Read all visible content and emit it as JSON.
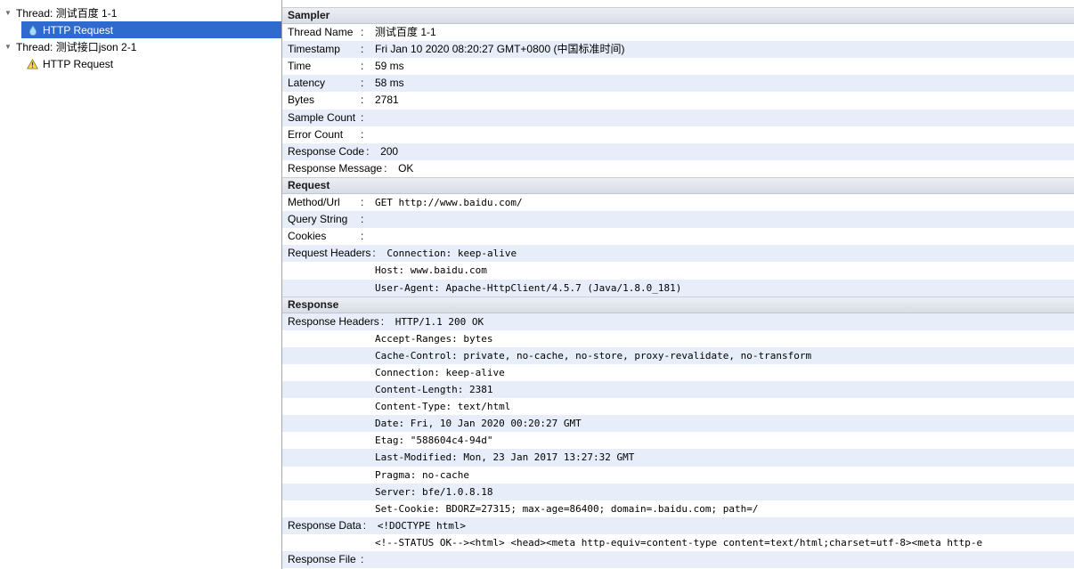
{
  "colors": {
    "selection_blue": "#2f6bce",
    "row_stripe_blue": "#e7eef9",
    "section_header_bg": "#dde1ea",
    "warning_yellow": "#ffd94a"
  },
  "field_separator": ":",
  "tree": {
    "items": [
      {
        "kind": "thread",
        "label": "Thread: 测试百度 1-1",
        "icon": "disclosure-triangle-icon",
        "selected": false
      },
      {
        "kind": "sampler",
        "label": "HTTP Request",
        "icon": "http-request-icon",
        "selected": true
      },
      {
        "kind": "thread",
        "label": "Thread: 测试接口json 2-1",
        "icon": "disclosure-triangle-icon",
        "selected": false
      },
      {
        "kind": "sampler",
        "label": "HTTP Request",
        "icon": "warning-icon",
        "selected": false
      }
    ]
  },
  "result": {
    "sections": [
      {
        "title": "Sampler",
        "rows": [
          {
            "label": "Thread Name",
            "value": "测试百度 1-1",
            "mono": false
          },
          {
            "label": "Timestamp",
            "value": "Fri Jan 10 2020 08:20:27 GMT+0800 (中国标准时间)",
            "mono": false
          },
          {
            "label": "Time",
            "value": "59 ms",
            "mono": false
          },
          {
            "label": "Latency",
            "value": "58 ms",
            "mono": false
          },
          {
            "label": "Bytes",
            "value": "2781",
            "mono": false
          },
          {
            "label": "Sample Count",
            "value": "",
            "mono": false
          },
          {
            "label": "Error Count",
            "value": "",
            "mono": false
          },
          {
            "label": "Response Code",
            "value": "200",
            "mono": false
          },
          {
            "label": "Response Message",
            "value": "OK",
            "mono": false
          }
        ]
      },
      {
        "title": "Request",
        "rows": [
          {
            "label": "Method/Url",
            "value": "GET http://www.baidu.com/",
            "mono": true
          },
          {
            "label": "Query String",
            "value": "",
            "mono": true
          },
          {
            "label": "Cookies",
            "value": "",
            "mono": true
          },
          {
            "label": "Request Headers",
            "mono": true,
            "values": [
              "Connection: keep-alive",
              "Host: www.baidu.com",
              "User-Agent: Apache-HttpClient/4.5.7 (Java/1.8.0_181)"
            ]
          }
        ]
      },
      {
        "title": "Response",
        "rows": [
          {
            "label": "Response Headers",
            "mono": true,
            "values": [
              "HTTP/1.1 200 OK",
              "Accept-Ranges: bytes",
              "Cache-Control: private, no-cache, no-store, proxy-revalidate, no-transform",
              "Connection: keep-alive",
              "Content-Length: 2381",
              "Content-Type: text/html",
              "Date: Fri, 10 Jan 2020 00:20:27 GMT",
              "Etag: \"588604c4-94d\"",
              "Last-Modified: Mon, 23 Jan 2017 13:27:32 GMT",
              "Pragma: no-cache",
              "Server: bfe/1.0.8.18",
              "Set-Cookie: BDORZ=27315; max-age=86400; domain=.baidu.com; path=/"
            ]
          },
          {
            "label": "Response Data",
            "mono": true,
            "values": [
              "<!DOCTYPE html>",
              "<!--STATUS OK--><html> <head><meta http-equiv=content-type content=text/html;charset=utf-8><meta http-e"
            ]
          },
          {
            "label": "Response File",
            "value": "",
            "mono": true
          }
        ]
      }
    ]
  }
}
